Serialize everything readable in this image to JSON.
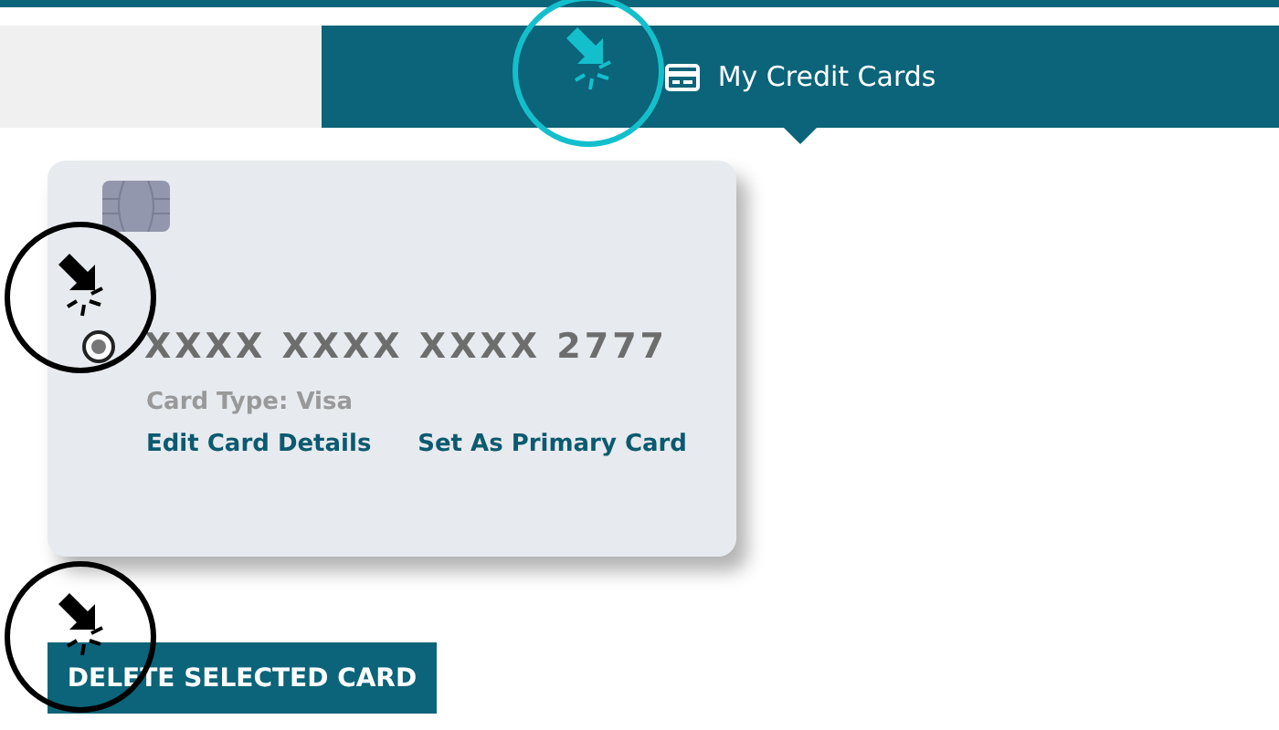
{
  "tabs": [
    {
      "selected": false
    },
    {
      "label": "My Credit Cards",
      "selected": true
    }
  ],
  "cards": [
    {
      "number": "XXXX XXXX XXXX 2777",
      "card_type": "Card Type: Visa",
      "selected": true,
      "links": [
        "Edit Card Details",
        "Set As Primary Card"
      ]
    }
  ],
  "delete_button": "DELETE SELECTED CARD",
  "click_markers": [
    {
      "color": "#14bfcc"
    },
    {
      "color": "#000000"
    },
    {
      "color": "#000000"
    }
  ]
}
